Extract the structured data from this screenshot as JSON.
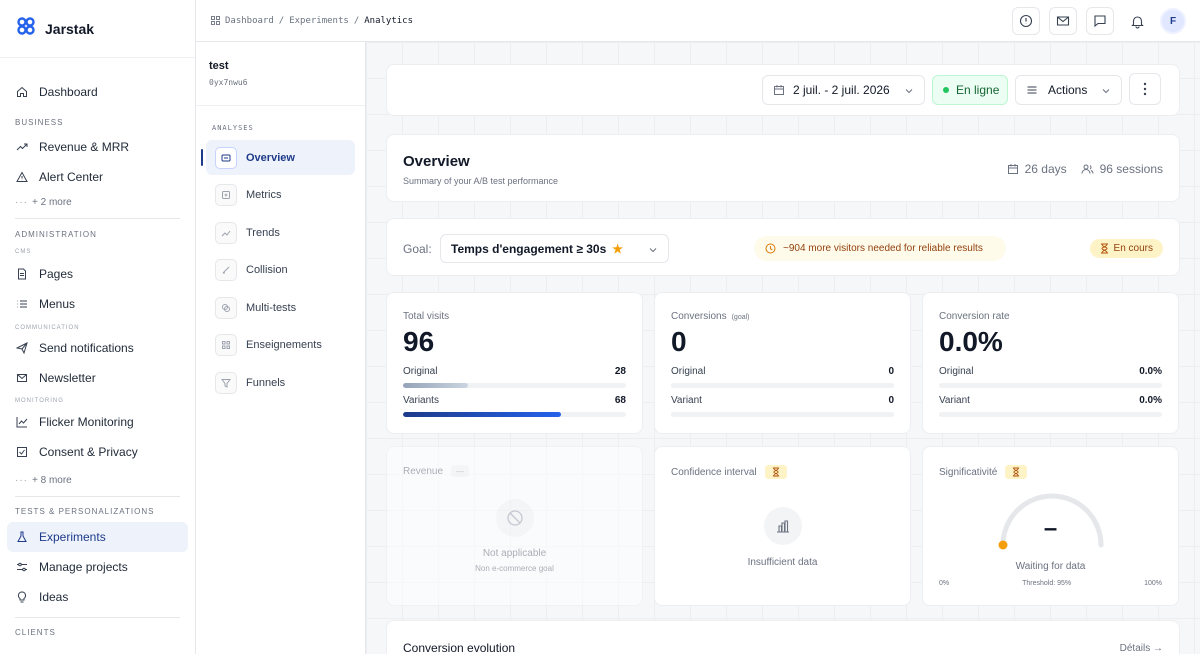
{
  "brand": {
    "name": "Jarstak"
  },
  "sidebar": {
    "dashboard": "Dashboard",
    "business_section": "Business",
    "revenue": "Revenue & MRR",
    "alert_center": "Alert Center",
    "more_business": "+ 2 more",
    "admin_section": "Administration",
    "cms_sub": "CMS",
    "pages": "Pages",
    "menus": "Menus",
    "communication_sub": "Communication",
    "send_notifications": "Send notifications",
    "newsletter": "Newsletter",
    "monitoring_sub": "Monitoring",
    "flicker_monitoring": "Flicker Monitoring",
    "consent_privacy": "Consent & Privacy",
    "more_admin": "+ 8 more",
    "tests_section": "Tests & Personalizations",
    "experiments": "Experiments",
    "manage_projects": "Manage projects",
    "ideas": "Ideas",
    "clients_section": "Clients"
  },
  "topbar": {
    "breadcrumb": [
      "Dashboard",
      "Experiments",
      "Analytics"
    ],
    "separator": "/",
    "avatar_initial": "F"
  },
  "subnav": {
    "title": "test",
    "id": "0yx7nwu6",
    "section": "ANALYSES",
    "items": [
      "Overview",
      "Metrics",
      "Trends",
      "Collision",
      "Multi-tests",
      "Enseignements",
      "Funnels"
    ]
  },
  "toolbar": {
    "date_range": "2 juil. - 2 juil. 2026",
    "status": "En ligne",
    "actions": "Actions"
  },
  "overview": {
    "title": "Overview",
    "subtitle": "Summary of your A/B test performance",
    "days": "26 days",
    "sessions": "96 sessions"
  },
  "goal": {
    "label": "Goal:",
    "value": "Temps d'engagement ≥ 30s",
    "warning": "~904 more visitors needed for reliable results",
    "status": "En cours"
  },
  "stats": {
    "visits": {
      "label": "Total visits",
      "value": "96",
      "original_label": "Original",
      "original_value": "28",
      "original_fraction": 0.29,
      "variants_label": "Variants",
      "variants_value": "68",
      "variants_fraction": 0.71
    },
    "conversions": {
      "label": "Conversions",
      "tag": "(goal)",
      "value": "0",
      "original_label": "Original",
      "original_value": "0",
      "variant_label": "Variant",
      "variant_value": "0"
    },
    "rate": {
      "label": "Conversion rate",
      "value": "0.0%",
      "original_label": "Original",
      "original_value": "0.0%",
      "variant_label": "Variant",
      "variant_value": "0.0%"
    }
  },
  "revenue": {
    "label": "Revenue",
    "badge": "—",
    "na": "Not applicable",
    "note": "Non e-commerce goal"
  },
  "confidence": {
    "label": "Confidence interval",
    "text": "Insufficient data"
  },
  "significance": {
    "label": "Significativité",
    "value": "–",
    "waiting": "Waiting for data",
    "min": "0%",
    "threshold": "Threshold: 95%",
    "max": "100%"
  },
  "evolution": {
    "title": "Conversion evolution",
    "link": "Détails →"
  },
  "colors": {
    "accent": "#1e3a8a",
    "success": "#22c55e",
    "warning": "#f59e0b",
    "bar_original": "#cbd5e1",
    "bar_variant": "#1d4ed8"
  }
}
